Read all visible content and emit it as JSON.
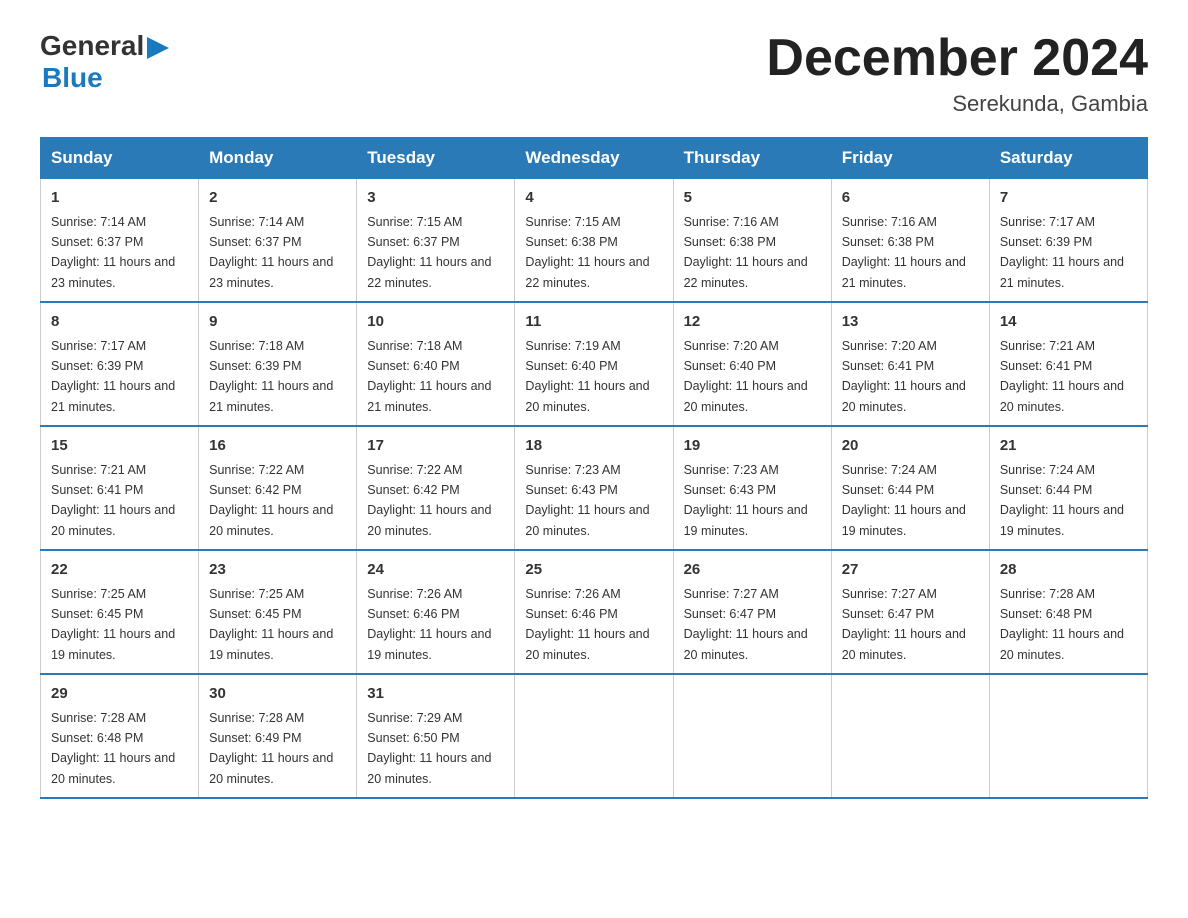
{
  "logo": {
    "general": "General",
    "blue": "Blue",
    "arrow": "▶"
  },
  "title": "December 2024",
  "subtitle": "Serekunda, Gambia",
  "days_of_week": [
    "Sunday",
    "Monday",
    "Tuesday",
    "Wednesday",
    "Thursday",
    "Friday",
    "Saturday"
  ],
  "weeks": [
    [
      {
        "day": "1",
        "sunrise": "Sunrise: 7:14 AM",
        "sunset": "Sunset: 6:37 PM",
        "daylight": "Daylight: 11 hours and 23 minutes."
      },
      {
        "day": "2",
        "sunrise": "Sunrise: 7:14 AM",
        "sunset": "Sunset: 6:37 PM",
        "daylight": "Daylight: 11 hours and 23 minutes."
      },
      {
        "day": "3",
        "sunrise": "Sunrise: 7:15 AM",
        "sunset": "Sunset: 6:37 PM",
        "daylight": "Daylight: 11 hours and 22 minutes."
      },
      {
        "day": "4",
        "sunrise": "Sunrise: 7:15 AM",
        "sunset": "Sunset: 6:38 PM",
        "daylight": "Daylight: 11 hours and 22 minutes."
      },
      {
        "day": "5",
        "sunrise": "Sunrise: 7:16 AM",
        "sunset": "Sunset: 6:38 PM",
        "daylight": "Daylight: 11 hours and 22 minutes."
      },
      {
        "day": "6",
        "sunrise": "Sunrise: 7:16 AM",
        "sunset": "Sunset: 6:38 PM",
        "daylight": "Daylight: 11 hours and 21 minutes."
      },
      {
        "day": "7",
        "sunrise": "Sunrise: 7:17 AM",
        "sunset": "Sunset: 6:39 PM",
        "daylight": "Daylight: 11 hours and 21 minutes."
      }
    ],
    [
      {
        "day": "8",
        "sunrise": "Sunrise: 7:17 AM",
        "sunset": "Sunset: 6:39 PM",
        "daylight": "Daylight: 11 hours and 21 minutes."
      },
      {
        "day": "9",
        "sunrise": "Sunrise: 7:18 AM",
        "sunset": "Sunset: 6:39 PM",
        "daylight": "Daylight: 11 hours and 21 minutes."
      },
      {
        "day": "10",
        "sunrise": "Sunrise: 7:18 AM",
        "sunset": "Sunset: 6:40 PM",
        "daylight": "Daylight: 11 hours and 21 minutes."
      },
      {
        "day": "11",
        "sunrise": "Sunrise: 7:19 AM",
        "sunset": "Sunset: 6:40 PM",
        "daylight": "Daylight: 11 hours and 20 minutes."
      },
      {
        "day": "12",
        "sunrise": "Sunrise: 7:20 AM",
        "sunset": "Sunset: 6:40 PM",
        "daylight": "Daylight: 11 hours and 20 minutes."
      },
      {
        "day": "13",
        "sunrise": "Sunrise: 7:20 AM",
        "sunset": "Sunset: 6:41 PM",
        "daylight": "Daylight: 11 hours and 20 minutes."
      },
      {
        "day": "14",
        "sunrise": "Sunrise: 7:21 AM",
        "sunset": "Sunset: 6:41 PM",
        "daylight": "Daylight: 11 hours and 20 minutes."
      }
    ],
    [
      {
        "day": "15",
        "sunrise": "Sunrise: 7:21 AM",
        "sunset": "Sunset: 6:41 PM",
        "daylight": "Daylight: 11 hours and 20 minutes."
      },
      {
        "day": "16",
        "sunrise": "Sunrise: 7:22 AM",
        "sunset": "Sunset: 6:42 PM",
        "daylight": "Daylight: 11 hours and 20 minutes."
      },
      {
        "day": "17",
        "sunrise": "Sunrise: 7:22 AM",
        "sunset": "Sunset: 6:42 PM",
        "daylight": "Daylight: 11 hours and 20 minutes."
      },
      {
        "day": "18",
        "sunrise": "Sunrise: 7:23 AM",
        "sunset": "Sunset: 6:43 PM",
        "daylight": "Daylight: 11 hours and 20 minutes."
      },
      {
        "day": "19",
        "sunrise": "Sunrise: 7:23 AM",
        "sunset": "Sunset: 6:43 PM",
        "daylight": "Daylight: 11 hours and 19 minutes."
      },
      {
        "day": "20",
        "sunrise": "Sunrise: 7:24 AM",
        "sunset": "Sunset: 6:44 PM",
        "daylight": "Daylight: 11 hours and 19 minutes."
      },
      {
        "day": "21",
        "sunrise": "Sunrise: 7:24 AM",
        "sunset": "Sunset: 6:44 PM",
        "daylight": "Daylight: 11 hours and 19 minutes."
      }
    ],
    [
      {
        "day": "22",
        "sunrise": "Sunrise: 7:25 AM",
        "sunset": "Sunset: 6:45 PM",
        "daylight": "Daylight: 11 hours and 19 minutes."
      },
      {
        "day": "23",
        "sunrise": "Sunrise: 7:25 AM",
        "sunset": "Sunset: 6:45 PM",
        "daylight": "Daylight: 11 hours and 19 minutes."
      },
      {
        "day": "24",
        "sunrise": "Sunrise: 7:26 AM",
        "sunset": "Sunset: 6:46 PM",
        "daylight": "Daylight: 11 hours and 19 minutes."
      },
      {
        "day": "25",
        "sunrise": "Sunrise: 7:26 AM",
        "sunset": "Sunset: 6:46 PM",
        "daylight": "Daylight: 11 hours and 20 minutes."
      },
      {
        "day": "26",
        "sunrise": "Sunrise: 7:27 AM",
        "sunset": "Sunset: 6:47 PM",
        "daylight": "Daylight: 11 hours and 20 minutes."
      },
      {
        "day": "27",
        "sunrise": "Sunrise: 7:27 AM",
        "sunset": "Sunset: 6:47 PM",
        "daylight": "Daylight: 11 hours and 20 minutes."
      },
      {
        "day": "28",
        "sunrise": "Sunrise: 7:28 AM",
        "sunset": "Sunset: 6:48 PM",
        "daylight": "Daylight: 11 hours and 20 minutes."
      }
    ],
    [
      {
        "day": "29",
        "sunrise": "Sunrise: 7:28 AM",
        "sunset": "Sunset: 6:48 PM",
        "daylight": "Daylight: 11 hours and 20 minutes."
      },
      {
        "day": "30",
        "sunrise": "Sunrise: 7:28 AM",
        "sunset": "Sunset: 6:49 PM",
        "daylight": "Daylight: 11 hours and 20 minutes."
      },
      {
        "day": "31",
        "sunrise": "Sunrise: 7:29 AM",
        "sunset": "Sunset: 6:50 PM",
        "daylight": "Daylight: 11 hours and 20 minutes."
      },
      null,
      null,
      null,
      null
    ]
  ]
}
